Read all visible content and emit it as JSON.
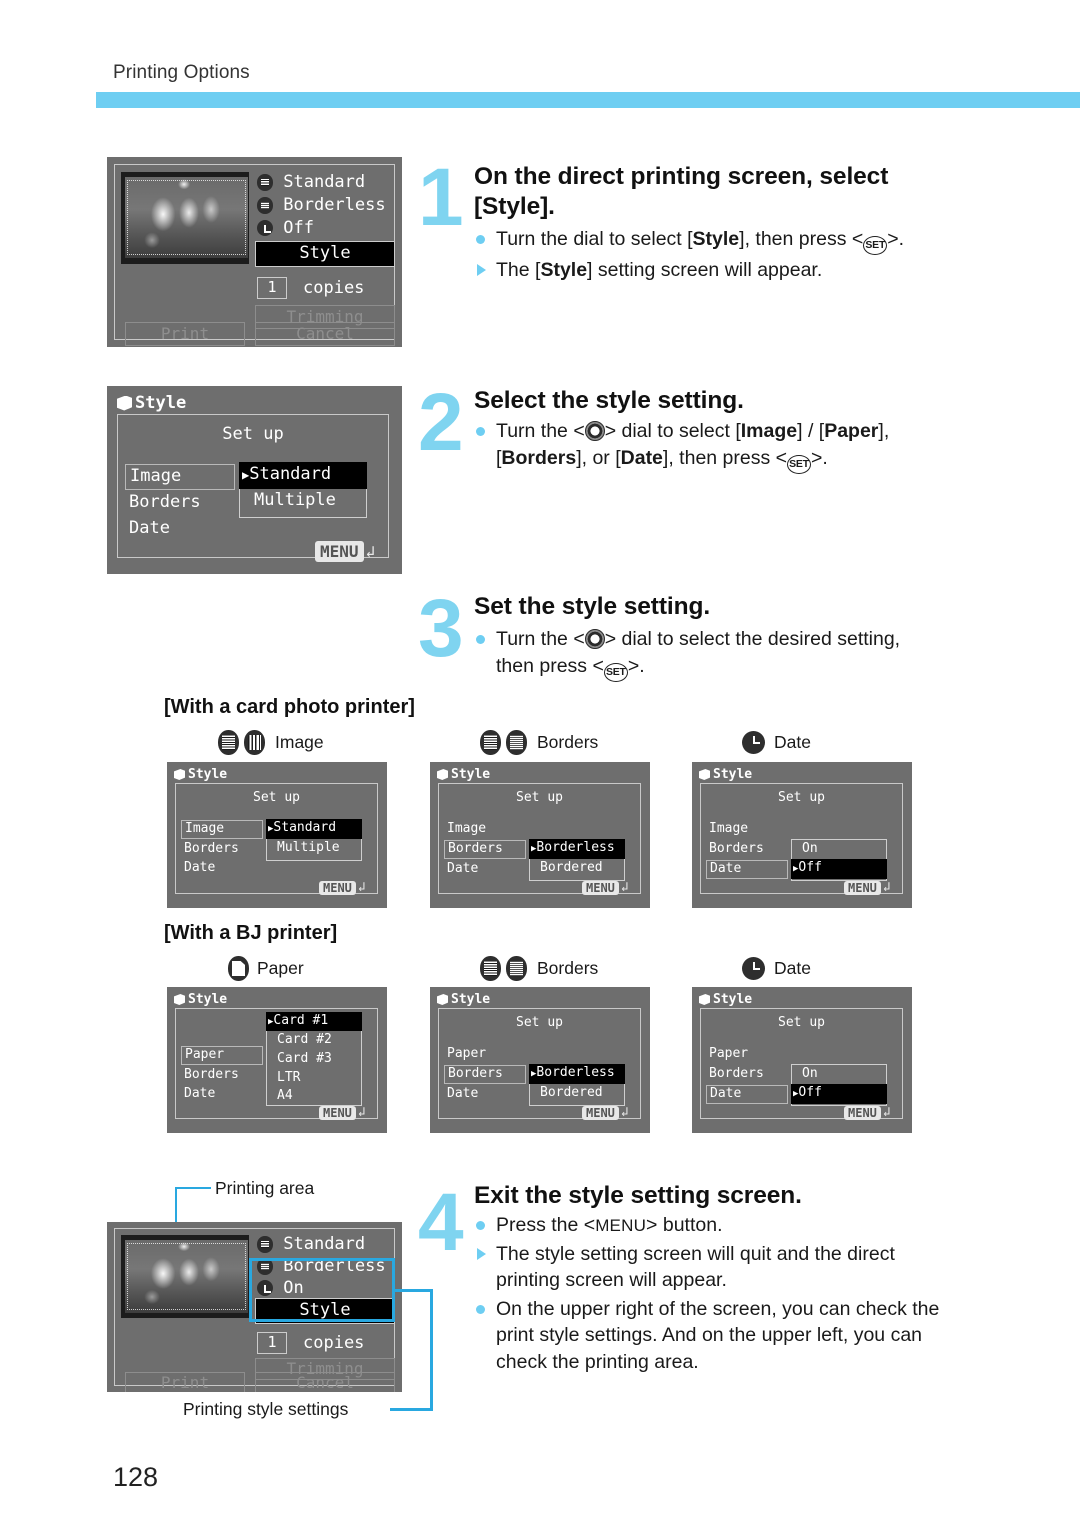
{
  "header": {
    "title": "Printing Options",
    "bar_color": "#6ecef2"
  },
  "page_number": "128",
  "steps": [
    {
      "num": "1",
      "title": "On the direct printing screen, select [Style].",
      "bullets": [
        {
          "type": "dot",
          "text": "Turn the dial to select [Style], then press <SET>."
        },
        {
          "type": "tri",
          "text": "The [Style] setting screen will appear."
        }
      ]
    },
    {
      "num": "2",
      "title": "Select the style setting.",
      "bullets": [
        {
          "type": "dot",
          "text": "Turn the <dial> dial to select [Image] / [Paper], [Borders], or [Date], then press <SET>."
        }
      ]
    },
    {
      "num": "3",
      "title": "Set the style setting.",
      "bullets": [
        {
          "type": "dot",
          "text": "Turn the <dial> dial to select the desired setting, then press <SET>."
        }
      ]
    },
    {
      "num": "4",
      "title": "Exit the style setting screen.",
      "bullets": [
        {
          "type": "dot",
          "text": "Press the <MENU> button."
        },
        {
          "type": "tri",
          "text": "The style setting screen will quit and the direct printing screen will appear."
        },
        {
          "type": "dot",
          "text": "On the upper right of the screen, you can check the print style settings. And on the upper left, you can check the printing area."
        }
      ]
    }
  ],
  "sections": {
    "card_printer": {
      "heading": "[With a card photo printer]",
      "columns": [
        {
          "icons": [
            "dots-printer-icon",
            "bars-printer-icon"
          ],
          "label": "Image"
        },
        {
          "icons": [
            "dots-printer-icon",
            "fine-printer-icon"
          ],
          "label": "Borders"
        },
        {
          "icons": [
            "clock-icon"
          ],
          "label": "Date"
        }
      ]
    },
    "bj_printer": {
      "heading": "[With a BJ printer]",
      "columns": [
        {
          "icons": [
            "paper-icon"
          ],
          "label": "Paper"
        },
        {
          "icons": [
            "dots-printer-icon",
            "fine-printer-icon"
          ],
          "label": "Borders"
        },
        {
          "icons": [
            "clock-icon"
          ],
          "label": "Date"
        }
      ]
    }
  },
  "screens": {
    "direct_print_1": {
      "title": "direct printing screen",
      "settings": [
        {
          "icon": "dots-printer-icon",
          "label": "Standard"
        },
        {
          "icon": "hatch-printer-icon",
          "label": "Borderless"
        },
        {
          "icon": "clock-icon",
          "label": "Off"
        }
      ],
      "style_button": "Style",
      "copies_value": "1",
      "copies_label": "copies",
      "trimming_button": "Trimming",
      "print_button": "Print",
      "cancel_button": "Cancel"
    },
    "direct_print_4": {
      "title": "direct printing screen",
      "settings": [
        {
          "icon": "dots-printer-icon",
          "label": "Standard"
        },
        {
          "icon": "hatch-printer-icon",
          "label": "Borderless"
        },
        {
          "icon": "clock-icon",
          "label": "On"
        }
      ],
      "style_button": "Style",
      "copies_value": "1",
      "copies_label": "copies",
      "trimming_button": "Trimming",
      "print_button": "Print",
      "cancel_button": "Cancel",
      "callout_top": "Printing area",
      "callout_bottom": "Printing style settings"
    },
    "style_main": {
      "title": "Style",
      "setup_label": "Set up",
      "menu_items": [
        "Image",
        "Borders",
        "Date"
      ],
      "highlighted_item": "Image",
      "options": [
        "Standard",
        "Multiple"
      ],
      "selected_option": "Standard",
      "menu_button": "MENU"
    },
    "card_image": {
      "title": "Style",
      "setup_label": "Set up",
      "menu_items": [
        "Image",
        "Borders",
        "Date"
      ],
      "highlighted_item": "Image",
      "options": [
        "Standard",
        "Multiple"
      ],
      "selected_option": "Standard",
      "menu_button": "MENU"
    },
    "card_borders": {
      "title": "Style",
      "setup_label": "Set up",
      "menu_items": [
        "Image",
        "Borders",
        "Date"
      ],
      "highlighted_item": "Borders",
      "options": [
        "Borderless",
        "Bordered"
      ],
      "selected_option": "Borderless",
      "menu_button": "MENU"
    },
    "card_date": {
      "title": "Style",
      "setup_label": "Set up",
      "menu_items": [
        "Image",
        "Borders",
        "Date"
      ],
      "highlighted_item": "Date",
      "options": [
        "On",
        "Off"
      ],
      "selected_option": "Off",
      "menu_button": "MENU"
    },
    "bj_paper": {
      "title": "Style",
      "setup_label": "",
      "menu_items": [
        "Paper",
        "Borders",
        "Date"
      ],
      "highlighted_item": "Paper",
      "options": [
        "Card #1",
        "Card #2",
        "Card #3",
        "LTR",
        "A4"
      ],
      "selected_option": "Card #1",
      "menu_button": "MENU"
    },
    "bj_borders": {
      "title": "Style",
      "setup_label": "Set up",
      "menu_items": [
        "Paper",
        "Borders",
        "Date"
      ],
      "highlighted_item": "Borders",
      "options": [
        "Borderless",
        "Bordered"
      ],
      "selected_option": "Borderless",
      "menu_button": "MENU"
    },
    "bj_date": {
      "title": "Style",
      "setup_label": "Set up",
      "menu_items": [
        "Paper",
        "Borders",
        "Date"
      ],
      "highlighted_item": "Date",
      "options": [
        "On",
        "Off"
      ],
      "selected_option": "Off",
      "menu_button": "MENU"
    }
  }
}
